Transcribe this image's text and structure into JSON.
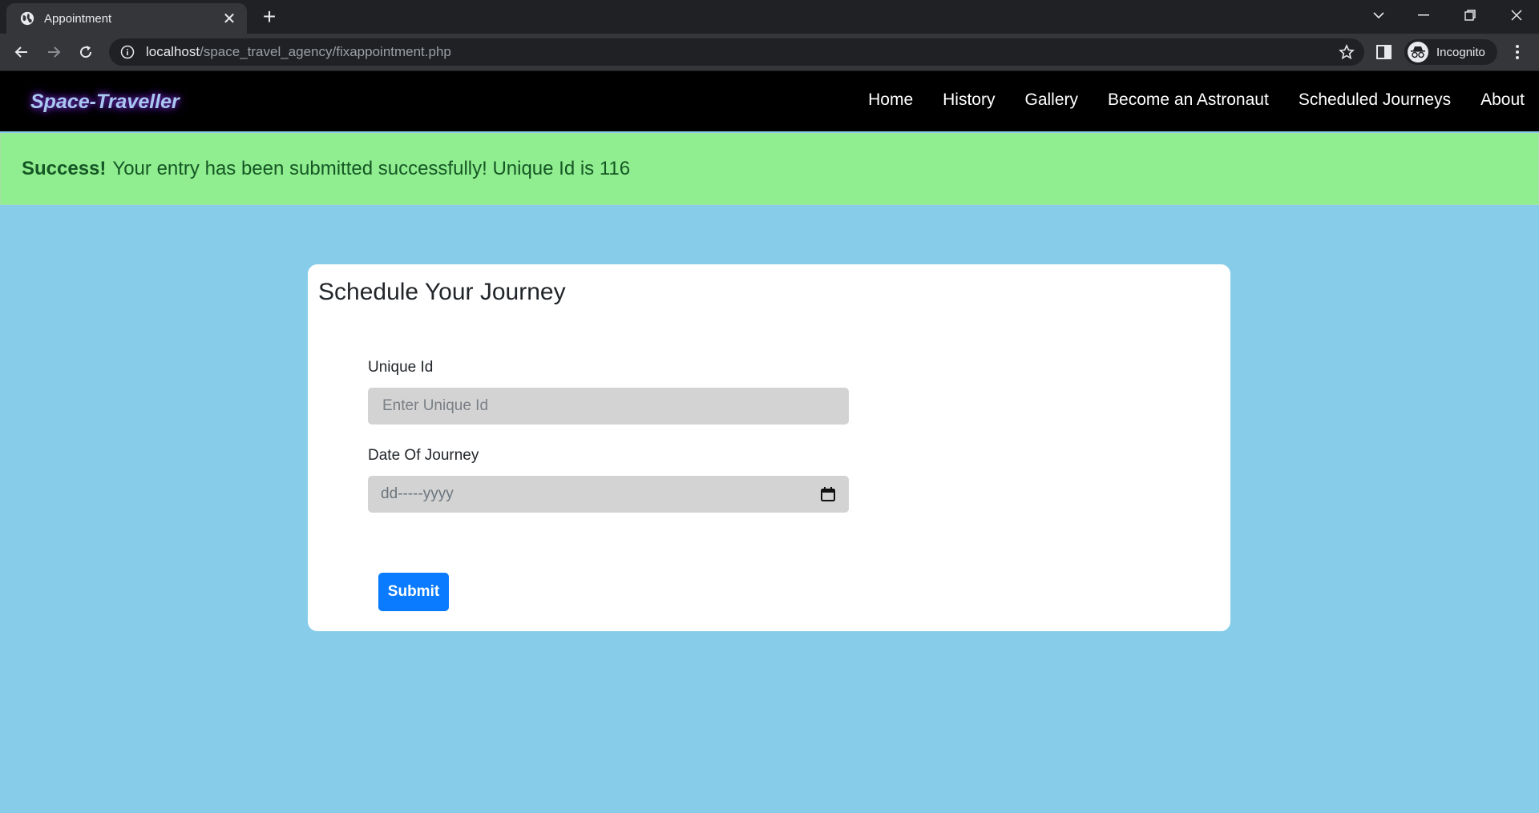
{
  "browser": {
    "tab_title": "Appointment",
    "url_host": "localhost",
    "url_path": "/space_travel_agency/fixappointment.php",
    "profile_label": "Incognito"
  },
  "site": {
    "brand": "Space-Traveller",
    "nav": [
      "Home",
      "History",
      "Gallery",
      "Become an Astronaut",
      "Scheduled Journeys",
      "About"
    ]
  },
  "alert": {
    "strong": "Success!",
    "message": "Your entry has been submitted successfully! Unique Id is 116"
  },
  "form": {
    "title": "Schedule Your Journey",
    "unique_id_label": "Unique Id",
    "unique_id_placeholder": "Enter Unique Id",
    "date_label": "Date Of Journey",
    "date_placeholder": "dd-----yyyy",
    "submit_label": "Submit"
  },
  "colors": {
    "page_bg": "#87cdea",
    "alert_bg": "#90ee90",
    "alert_text": "#155724",
    "submit_bg": "#0a7bff",
    "nav_bg": "#000000"
  }
}
